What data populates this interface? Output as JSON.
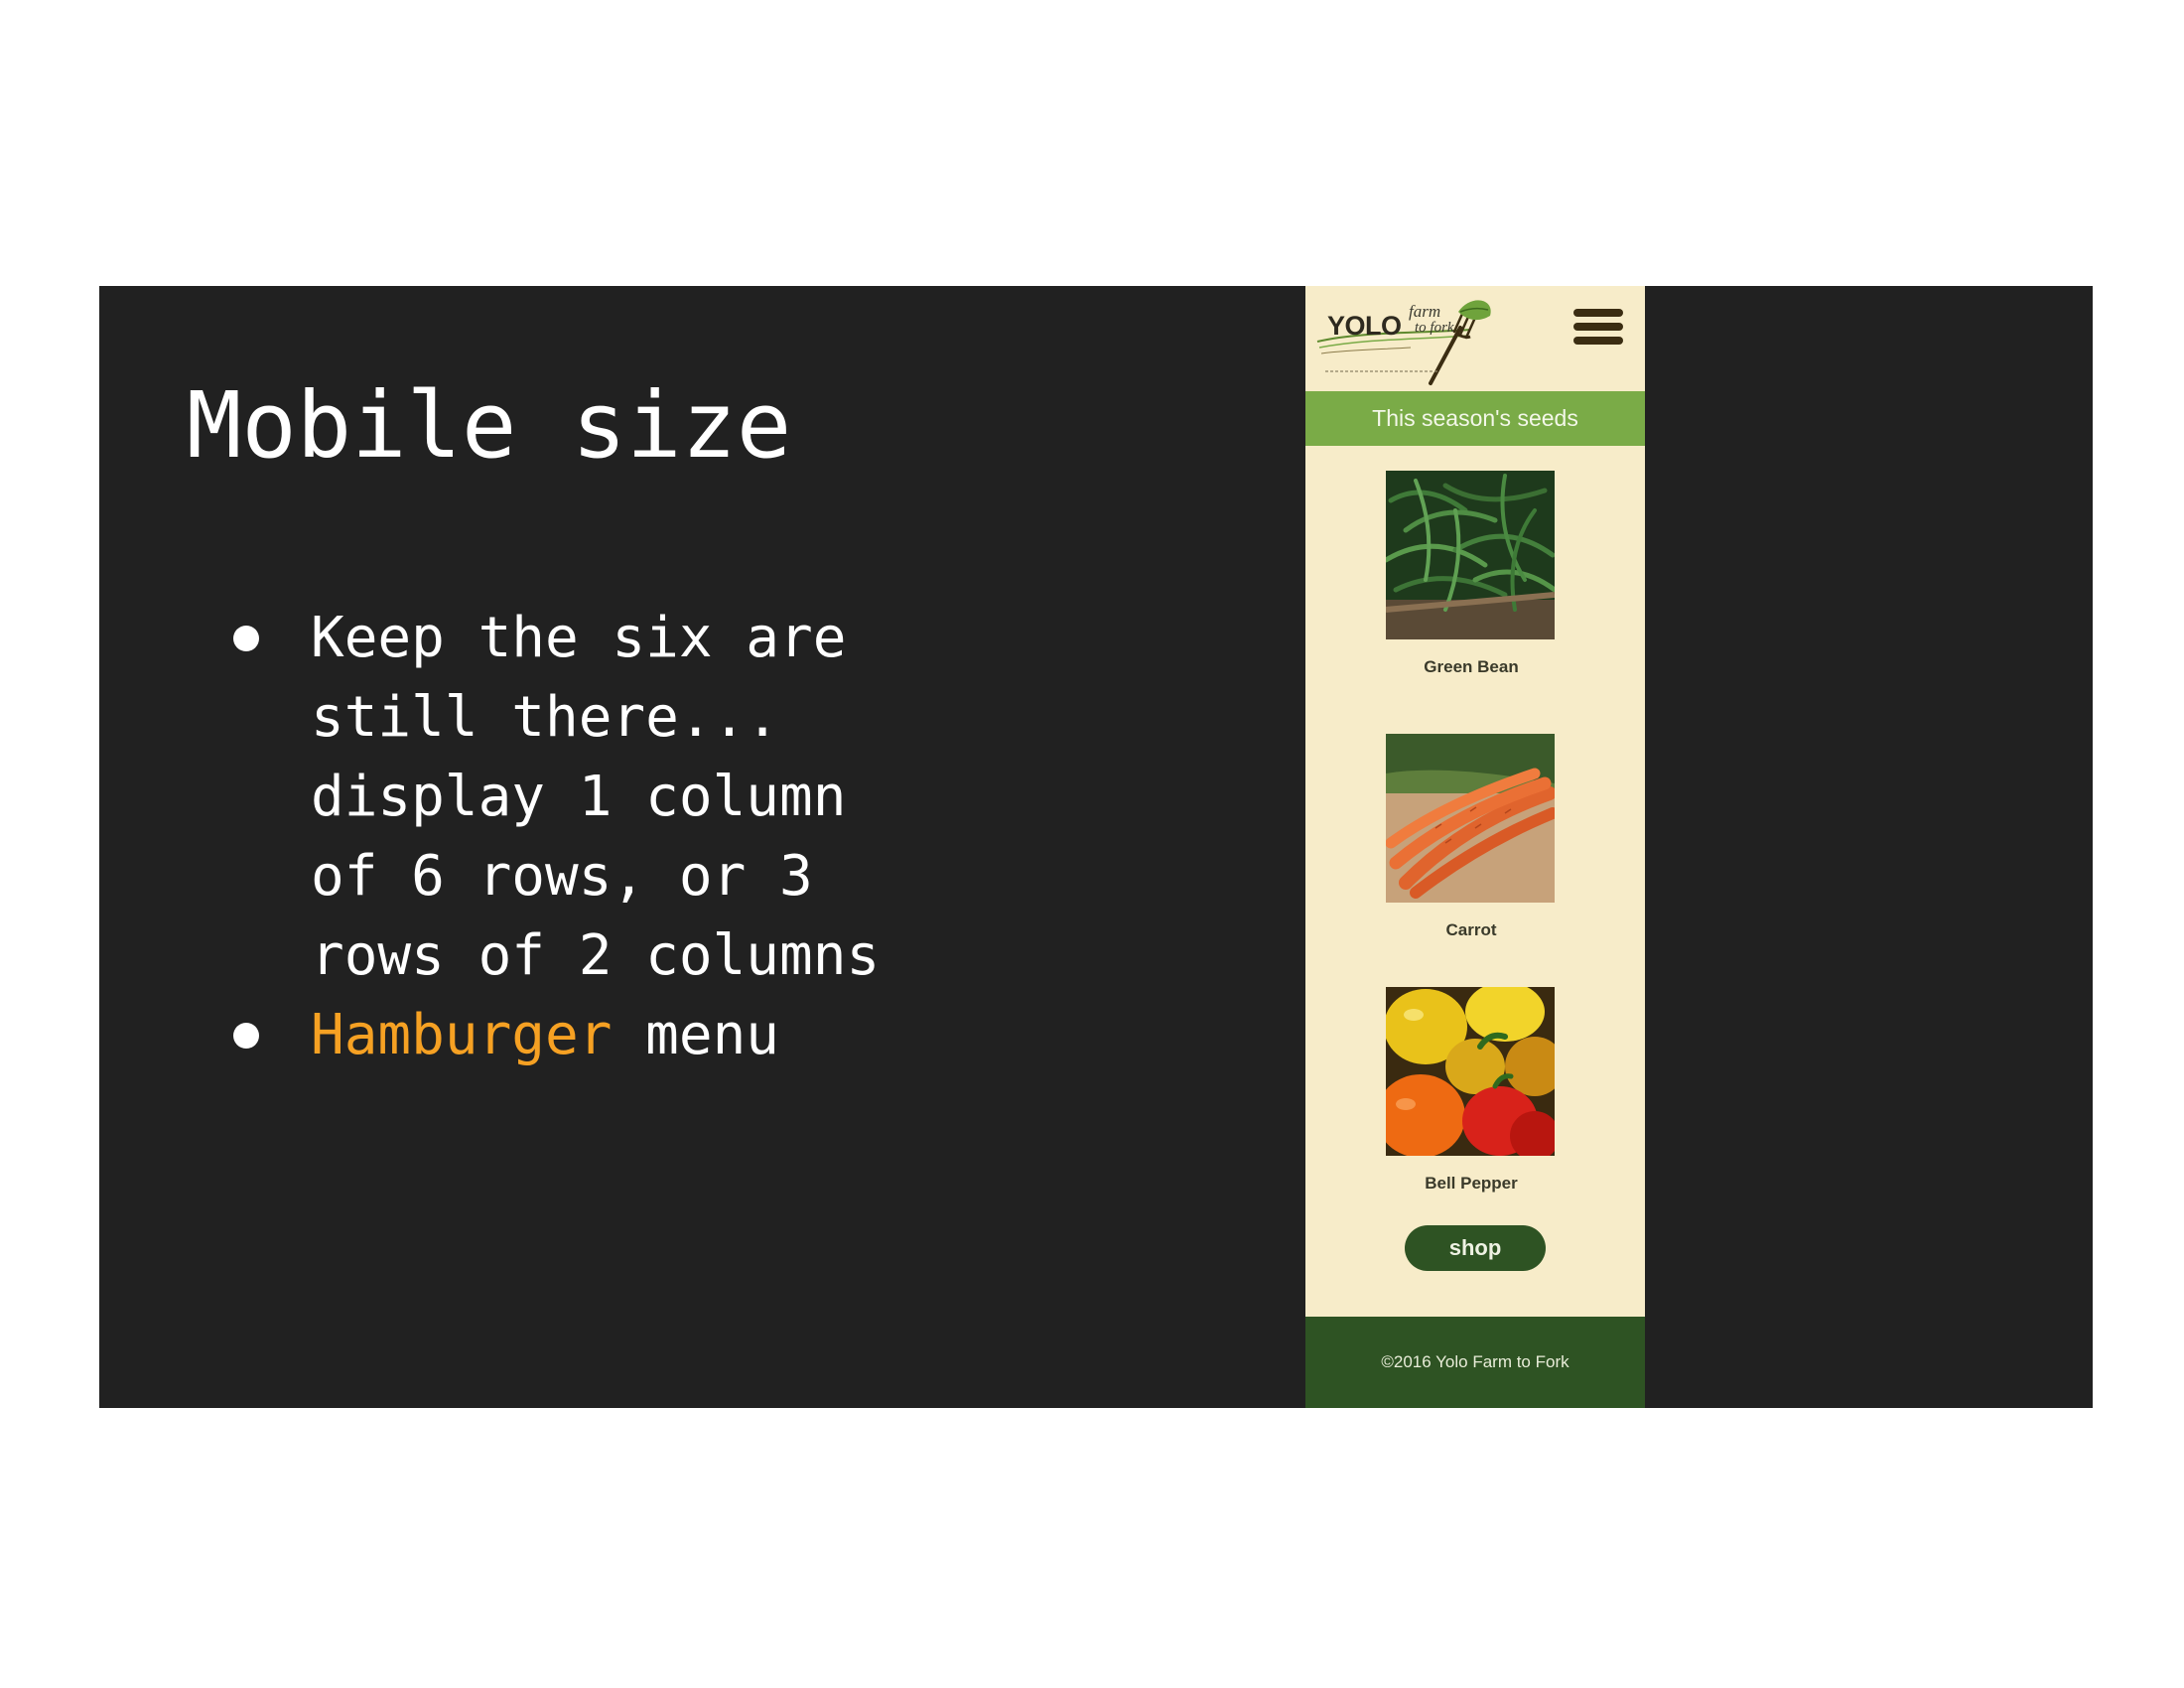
{
  "slide": {
    "title": "Mobile size",
    "bullets": [
      {
        "text": "Keep the six are still there... display 1 column of 6 rows, or 3 rows of 2 columns"
      },
      {
        "highlight": "Hamburger",
        "rest": " menu"
      }
    ]
  },
  "phone": {
    "logo": {
      "name": "YOLO",
      "script_top": "farm",
      "script_bottom": "to fork",
      "icon": "fork-leaf-icon"
    },
    "menu_icon": "hamburger-menu-icon",
    "banner": "This season's seeds",
    "products": [
      {
        "label": "Green Bean",
        "image": "green-bean-photo"
      },
      {
        "label": "Carrot",
        "image": "carrot-photo"
      },
      {
        "label": "Bell Pepper",
        "image": "bell-pepper-photo"
      }
    ],
    "shop_label": "shop",
    "footer": "©2016 Yolo Farm to Fork"
  },
  "colors": {
    "slide_background": "#212121",
    "highlight": "#f6a123",
    "phone_background": "#f7ecc9",
    "banner_green": "#7aab47",
    "dark_green": "#2e5323"
  }
}
